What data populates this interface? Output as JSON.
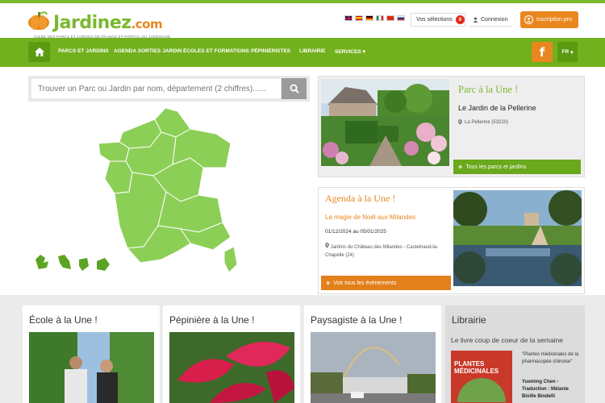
{
  "header": {
    "brand_name": "Jardinez",
    "brand_tld": ".com",
    "tagline": "GUIDE DES PARCS ET JARDINS DE FRANCE ET PORTAIL DU JARDINAGE",
    "languages": [
      "en",
      "es",
      "de",
      "it",
      "cn",
      "ru"
    ],
    "selections_label": "Vos sélections",
    "selections_count": "0",
    "connexion_label": "Connexion",
    "inscription_label": "Inscription pro"
  },
  "nav": {
    "items": [
      "PARCS ET JARDINS",
      "AGENDA SORTIES JARDIN",
      "ÉCOLES ET FORMATIONS",
      "PÉPINIÉRISTES",
      "LIBRAIRIE",
      "SERVICES"
    ],
    "facebook_icon": "f",
    "lang_label": "FR"
  },
  "search": {
    "placeholder": "Trouver un Parc ou Jardin par nom, département (2 chiffres)......"
  },
  "parc": {
    "heading": "Parc à la Une !",
    "title": "Le Jardin de la Pellerine",
    "location": "La Pellerine (53220)",
    "button_label": "Tous les parcs et jardins"
  },
  "agenda": {
    "heading": "Agenda à la Une !",
    "event": "La magie de Noël aux Milandes",
    "dates": "01/12/2024 au 05/01/2025",
    "location": "Jardins du Château des Milandes - Castelnaud-la-Chapelle (24)",
    "button_label": "Voir tous les évènements"
  },
  "bottom": {
    "ecole_title": "École à la Une !",
    "pepiniere_title": "Pépinière à la Une !",
    "paysagiste_title": "Paysagiste à la Une !",
    "librairie_title": "Librairie",
    "librairie_sub": "Le livre coup de coeur de la semaine",
    "book_quote": "\"Plantes médicinales de la pharmacopée chinoise\"",
    "book_author": "Yueming Chen - Traduction : Mélanie Biville Bindelli",
    "book_cover_text": "PLANTES MÉDICINALES"
  },
  "colors": {
    "green": "#72b01d",
    "orange": "#e9871f"
  }
}
